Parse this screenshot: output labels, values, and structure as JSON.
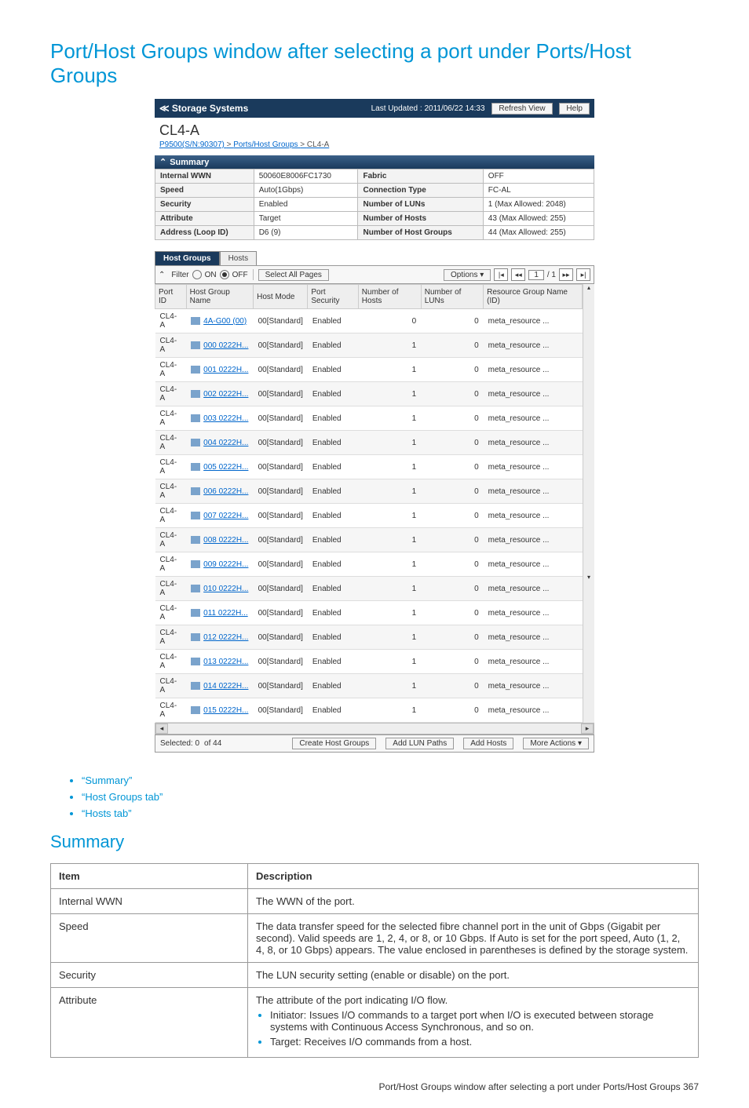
{
  "page_title": "Port/Host Groups window after selecting a port under Ports/Host Groups",
  "topbar": {
    "storage": "≪ Storage Systems",
    "updated": "Last Updated : 2011/06/22 14:33",
    "refresh": "Refresh View",
    "help": "Help"
  },
  "port_name": "CL4-A",
  "breadcrumb": {
    "a": "P9500(S/N:90307)",
    "b": "Ports/Host Groups",
    "c": "CL4-A"
  },
  "summary_bar": "Summary",
  "summary": [
    {
      "k1": "Internal WWN",
      "v1": "50060E8006FC1730",
      "k2": "Fabric",
      "v2": "OFF"
    },
    {
      "k1": "Speed",
      "v1": "Auto(1Gbps)",
      "k2": "Connection Type",
      "v2": "FC-AL"
    },
    {
      "k1": "Security",
      "v1": "Enabled",
      "k2": "Number of LUNs",
      "v2": "1 (Max Allowed: 2048)"
    },
    {
      "k1": "Attribute",
      "v1": "Target",
      "k2": "Number of Hosts",
      "v2": "43 (Max Allowed: 255)"
    },
    {
      "k1": "Address (Loop ID)",
      "v1": "D6 (9)",
      "k2": "Number of Host Groups",
      "v2": "44 (Max Allowed: 255)"
    }
  ],
  "tabs": {
    "active": "Host Groups",
    "inactive": "Hosts"
  },
  "filter": {
    "label": "Filter",
    "on": "ON",
    "off": "OFF",
    "select_all": "Select All Pages",
    "options": "Options",
    "page": "1",
    "ofpages": "/ 1"
  },
  "cols": [
    "Port ID",
    "Host Group Name",
    "Host Mode",
    "Port Security",
    "Number of Hosts",
    "Number of LUNs",
    "Resource Group Name (ID)"
  ],
  "rows": [
    {
      "port": "CL4-A",
      "hg": "4A-G00 (00)",
      "mode": "00[Standard]",
      "sec": "Enabled",
      "nh": "0",
      "nl": "0",
      "rg": "meta_resource ..."
    },
    {
      "port": "CL4-A",
      "hg": "000 0222H...",
      "mode": "00[Standard]",
      "sec": "Enabled",
      "nh": "1",
      "nl": "0",
      "rg": "meta_resource ..."
    },
    {
      "port": "CL4-A",
      "hg": "001 0222H...",
      "mode": "00[Standard]",
      "sec": "Enabled",
      "nh": "1",
      "nl": "0",
      "rg": "meta_resource ..."
    },
    {
      "port": "CL4-A",
      "hg": "002 0222H...",
      "mode": "00[Standard]",
      "sec": "Enabled",
      "nh": "1",
      "nl": "0",
      "rg": "meta_resource ..."
    },
    {
      "port": "CL4-A",
      "hg": "003 0222H...",
      "mode": "00[Standard]",
      "sec": "Enabled",
      "nh": "1",
      "nl": "0",
      "rg": "meta_resource ..."
    },
    {
      "port": "CL4-A",
      "hg": "004 0222H...",
      "mode": "00[Standard]",
      "sec": "Enabled",
      "nh": "1",
      "nl": "0",
      "rg": "meta_resource ..."
    },
    {
      "port": "CL4-A",
      "hg": "005 0222H...",
      "mode": "00[Standard]",
      "sec": "Enabled",
      "nh": "1",
      "nl": "0",
      "rg": "meta_resource ..."
    },
    {
      "port": "CL4-A",
      "hg": "006 0222H...",
      "mode": "00[Standard]",
      "sec": "Enabled",
      "nh": "1",
      "nl": "0",
      "rg": "meta_resource ..."
    },
    {
      "port": "CL4-A",
      "hg": "007 0222H...",
      "mode": "00[Standard]",
      "sec": "Enabled",
      "nh": "1",
      "nl": "0",
      "rg": "meta_resource ..."
    },
    {
      "port": "CL4-A",
      "hg": "008 0222H...",
      "mode": "00[Standard]",
      "sec": "Enabled",
      "nh": "1",
      "nl": "0",
      "rg": "meta_resource ..."
    },
    {
      "port": "CL4-A",
      "hg": "009 0222H...",
      "mode": "00[Standard]",
      "sec": "Enabled",
      "nh": "1",
      "nl": "0",
      "rg": "meta_resource ..."
    },
    {
      "port": "CL4-A",
      "hg": "010 0222H...",
      "mode": "00[Standard]",
      "sec": "Enabled",
      "nh": "1",
      "nl": "0",
      "rg": "meta_resource ..."
    },
    {
      "port": "CL4-A",
      "hg": "011 0222H...",
      "mode": "00[Standard]",
      "sec": "Enabled",
      "nh": "1",
      "nl": "0",
      "rg": "meta_resource ..."
    },
    {
      "port": "CL4-A",
      "hg": "012 0222H...",
      "mode": "00[Standard]",
      "sec": "Enabled",
      "nh": "1",
      "nl": "0",
      "rg": "meta_resource ..."
    },
    {
      "port": "CL4-A",
      "hg": "013 0222H...",
      "mode": "00[Standard]",
      "sec": "Enabled",
      "nh": "1",
      "nl": "0",
      "rg": "meta_resource ..."
    },
    {
      "port": "CL4-A",
      "hg": "014 0222H...",
      "mode": "00[Standard]",
      "sec": "Enabled",
      "nh": "1",
      "nl": "0",
      "rg": "meta_resource ..."
    },
    {
      "port": "CL4-A",
      "hg": "015 0222H...",
      "mode": "00[Standard]",
      "sec": "Enabled",
      "nh": "1",
      "nl": "0",
      "rg": "meta_resource ..."
    }
  ],
  "footer": {
    "selected": "Selected:  0",
    "of": "of  44",
    "create": "Create Host Groups",
    "addlun": "Add LUN Paths",
    "addhosts": "Add Hosts",
    "more": "More Actions"
  },
  "links": [
    "“Summary”",
    "“Host Groups tab”",
    "“Hosts tab”"
  ],
  "sub_heading": "Summary",
  "desc_head": {
    "item": "Item",
    "desc": "Description"
  },
  "desc": [
    {
      "item": "Internal WWN",
      "desc": "The WWN of the port."
    },
    {
      "item": "Speed",
      "desc": "The data transfer speed for the selected fibre channel port in the unit of Gbps (Gigabit per second). Valid speeds are 1, 2, 4, or 8, or 10 Gbps. If Auto is set for the port speed, Auto (1, 2, 4, 8, or 10 Gbps) appears. The value enclosed in parentheses is defined by the storage system."
    },
    {
      "item": "Security",
      "desc": "The LUN security setting (enable or disable) on the port."
    },
    {
      "item": "Attribute",
      "desc": "The attribute of the port indicating I/O flow.",
      "bullets": [
        "Initiator: Issues I/O commands to a target port when I/O is executed between storage systems with Continuous Access Synchronous, and so on.",
        "Target: Receives I/O commands from a host."
      ]
    }
  ],
  "page_footer": "Port/Host Groups window after selecting a port under Ports/Host Groups   367"
}
